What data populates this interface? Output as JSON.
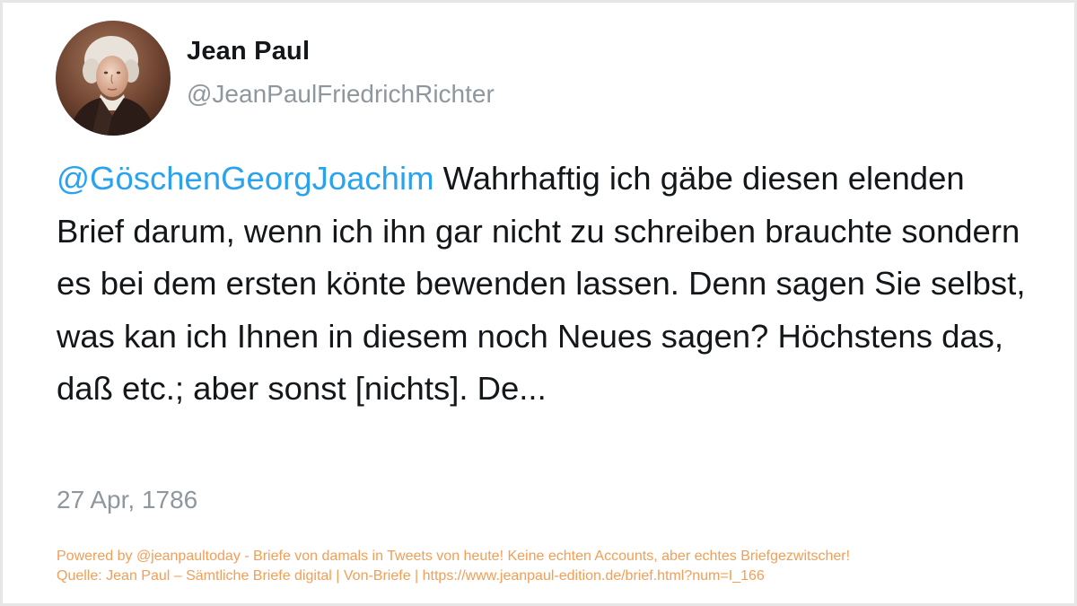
{
  "author": {
    "display_name": "Jean Paul",
    "handle": "@JeanPaulFriedrichRichter"
  },
  "tweet": {
    "mention": "@GöschenGeorgJoachim",
    "text": " Wahrhaftig ich gäbe diesen elenden Brief darum, wenn ich ihn gar nicht zu schreiben brauchte sondern es bei dem ersten könte bewenden lassen. Denn sagen Sie selbst, was kan ich Ihnen in diesem noch Neues sagen? Höchstens das, daß etc.; aber sonst [nichts]. De...",
    "date": "27 Apr, 1786"
  },
  "footer": {
    "line1": "Powered by @jeanpaultoday - Briefe von damals in Tweets von heute! Keine echten Accounts, aber echtes Briefgezwitscher!",
    "line2": "Quelle: Jean Paul – Sämtliche Briefe digital | Von-Briefe | https://www.jeanpaul-edition.de/brief.html?num=I_166"
  },
  "colors": {
    "mention": "#2aa3ef",
    "text": "#14171a",
    "muted": "#8f979e",
    "footer": "#f39e56"
  }
}
